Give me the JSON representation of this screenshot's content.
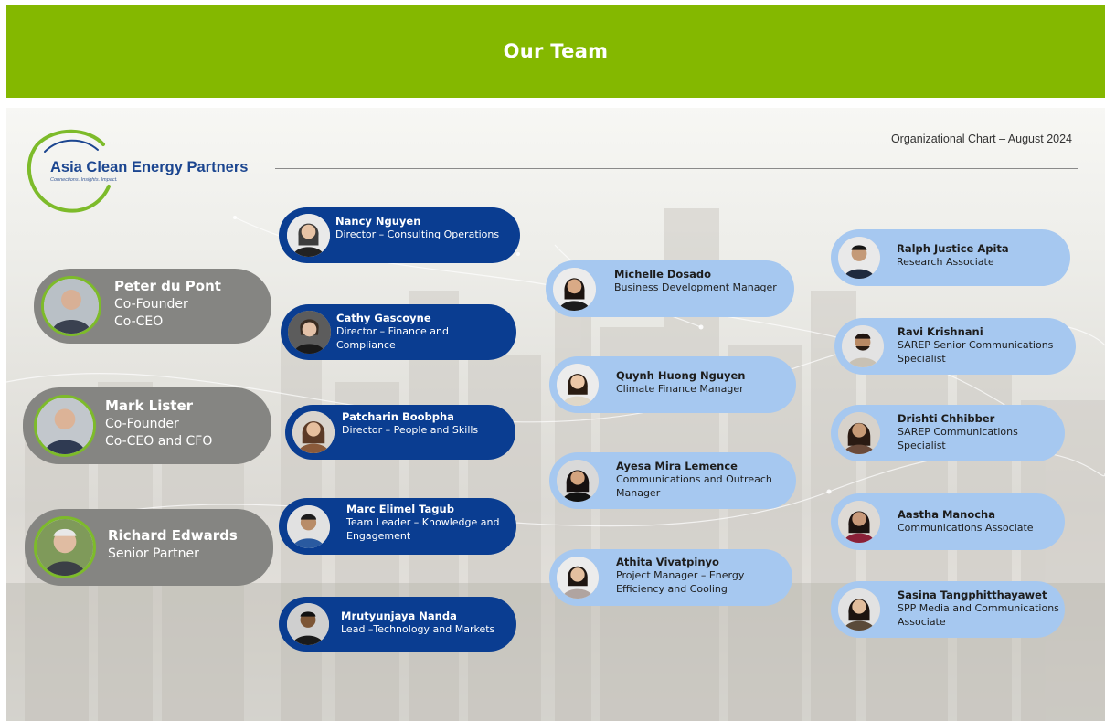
{
  "banner": {
    "title": "Our Team"
  },
  "logo": {
    "name": "Asia Clean Energy Partners",
    "tagline": "Connections. Insights. Impact."
  },
  "chart_date": "Organizational Chart – August 2024",
  "colors": {
    "banner": "#84b800",
    "navy": "#0a3d91",
    "light_blue": "#a6c8f0",
    "gray": "#858582",
    "logo_arc": "#7dbb2a",
    "logo_text": "#1c4690"
  },
  "leaders": [
    {
      "name": "Peter du Pont",
      "role1": "Co-Founder",
      "role2": "Co-CEO"
    },
    {
      "name": "Mark Lister",
      "role1": "Co-Founder",
      "role2": "Co-CEO and CFO"
    },
    {
      "name": "Richard Edwards",
      "role1": "Senior Partner"
    }
  ],
  "directors": [
    {
      "name": "Nancy Nguyen",
      "role": "Director – Consulting Operations"
    },
    {
      "name": "Cathy Gascoyne",
      "role": "Director – Finance and Compliance"
    },
    {
      "name": "Patcharin Boobpha",
      "role": "Director – People and Skills"
    },
    {
      "name": "Marc Elimel Tagub",
      "role": "Team Leader – Knowledge and Engagement"
    },
    {
      "name": "Mrutyunjaya Nanda",
      "role": "Lead –Technology and Markets"
    }
  ],
  "managers": [
    {
      "name": "Michelle Dosado",
      "role": "Business Development Manager"
    },
    {
      "name": "Quynh Huong Nguyen",
      "role": "Climate Finance Manager"
    },
    {
      "name": "Ayesa Mira Lemence",
      "role": "Communications and Outreach Manager"
    },
    {
      "name": "Athita Vivatpinyo",
      "role": "Project Manager – Energy Efficiency and Cooling"
    }
  ],
  "associates": [
    {
      "name": "Ralph Justice Apita",
      "role": "Research Associate"
    },
    {
      "name": "Ravi Krishnani",
      "role": "SAREP Senior Communications Specialist"
    },
    {
      "name": "Drishti Chhibber",
      "role": "SAREP Communications Specialist"
    },
    {
      "name": "Aastha Manocha",
      "role": "Communications Associate"
    },
    {
      "name": "Sasina Tangphitthayawet",
      "role": "SPP Media and Communications Associate"
    }
  ]
}
